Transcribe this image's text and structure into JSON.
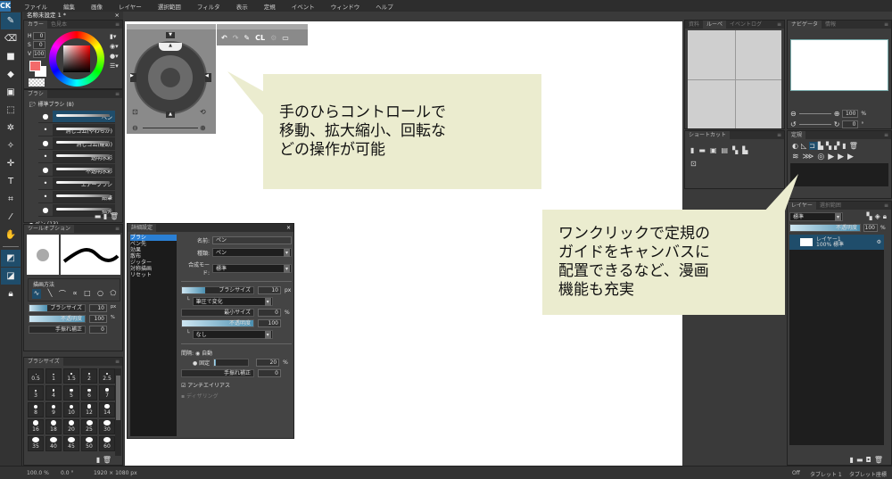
{
  "app": {
    "logo": "CK"
  },
  "menu": [
    "ファイル",
    "編集",
    "画像",
    "レイヤー",
    "選択範囲",
    "フィルタ",
    "表示",
    "定規",
    "イベント",
    "ウィンドウ",
    "ヘルプ"
  ],
  "document_tab": {
    "title": "名称未設定 1 *",
    "close": "×"
  },
  "color_panel": {
    "tabs": [
      "カラー",
      "色見本"
    ],
    "h": "0",
    "s": "0",
    "v": "100",
    "h_label": "H",
    "s_label": "S",
    "v_label": "V",
    "foreground": "#f26a6a",
    "background": "#ffffff"
  },
  "brush_panel": {
    "title": "ブラシ",
    "group1": "標準ブラシ (8)",
    "brushes": [
      "ペン",
      "消しゴム(やわらか)",
      "消しゴム(硬め)",
      "透明水彩",
      "不透明水彩",
      "エアーブラシ",
      "鉛筆",
      "指先"
    ],
    "group2": "ペン (13)"
  },
  "tool_option": {
    "title": "ツールオプション",
    "draw_method": "描画方法",
    "brush_size_label": "ブラシサイズ",
    "brush_size": "10",
    "brush_size_unit": "px",
    "opacity_label": "不透明度",
    "opacity": "100",
    "opacity_unit": "%",
    "stabilizer_label": "手振れ補正",
    "stabilizer": "0"
  },
  "brush_size_panel": {
    "title": "ブラシサイズ",
    "sizes": [
      "0.5",
      "1",
      "1.5",
      "2",
      "2.5",
      "3",
      "4",
      "5",
      "6",
      "7",
      "8",
      "9",
      "10",
      "12",
      "14",
      "16",
      "18",
      "20",
      "25",
      "30",
      "35",
      "40",
      "45",
      "50",
      "60"
    ]
  },
  "detail_panel": {
    "title": "詳細設定",
    "close": "×",
    "categories": [
      "ブラシ",
      "ペン先",
      "効果",
      "散布",
      "ジッター",
      "対称描画",
      "リセット"
    ],
    "name_label": "名前:",
    "name": "ペン",
    "type_label": "種類:",
    "type": "ペン",
    "blend_label": "合成モード:",
    "blend": "標準",
    "size_label": "ブラシサイズ",
    "size": "10",
    "size_unit": "px",
    "pressure": "筆圧で変化",
    "min_size_label": "最小サイズ",
    "min_size": "0",
    "min_size_unit": "%",
    "opacity_label": "不透明度",
    "opacity": "100",
    "opacity_mode": "なし",
    "interval_label": "間隔:",
    "auto": "自動",
    "fixed": "固定",
    "interval": "20",
    "interval_unit": "%",
    "stabilizer_label": "手振れ補正",
    "stabilizer": "0",
    "antialias": "アンチエイリアス",
    "dither": "ディザリング"
  },
  "quick_bar": {
    "cl": "CL"
  },
  "callout1": {
    "line1": "手のひらコントロールで",
    "line2": "移動、拡大縮小、回転な",
    "line3": "どの操作が可能"
  },
  "callout2": {
    "line1": "ワンクリックで定規の",
    "line2": "ガイドをキャンバスに",
    "line3": "配置できるなど、漫画",
    "line4": "機能も充実"
  },
  "loupe_panel": {
    "tabs": [
      "資料",
      "ルーペ",
      "イベントログ"
    ]
  },
  "shortcut_panel": {
    "title": "ショートカット"
  },
  "navigator_panel": {
    "tabs": [
      "ナビゲータ",
      "情報"
    ],
    "zoom": "100",
    "zoom_unit": "%",
    "rotation": "0",
    "rotation_unit": "°"
  },
  "ruler_panel": {
    "title": "定規"
  },
  "layer_panel": {
    "tabs": [
      "レイヤー",
      "選択範囲"
    ],
    "blend": "標準",
    "opacity_label": "不透明度",
    "opacity": "100",
    "opacity_unit": "%",
    "layers": [
      {
        "name": "レイヤー1",
        "info": "100% 標準"
      }
    ]
  },
  "status_bar": {
    "zoom": "100.0 %",
    "angle": "0.0 °",
    "size": "1920 × 1080 px",
    "tablet_mode": "Off",
    "tablet": "タブレット 1",
    "tablet_coords": "タブレット座標"
  },
  "colors": {
    "accent": "#1f4d6b",
    "callout": "#ebeccf",
    "canvas": "#ffffff"
  }
}
